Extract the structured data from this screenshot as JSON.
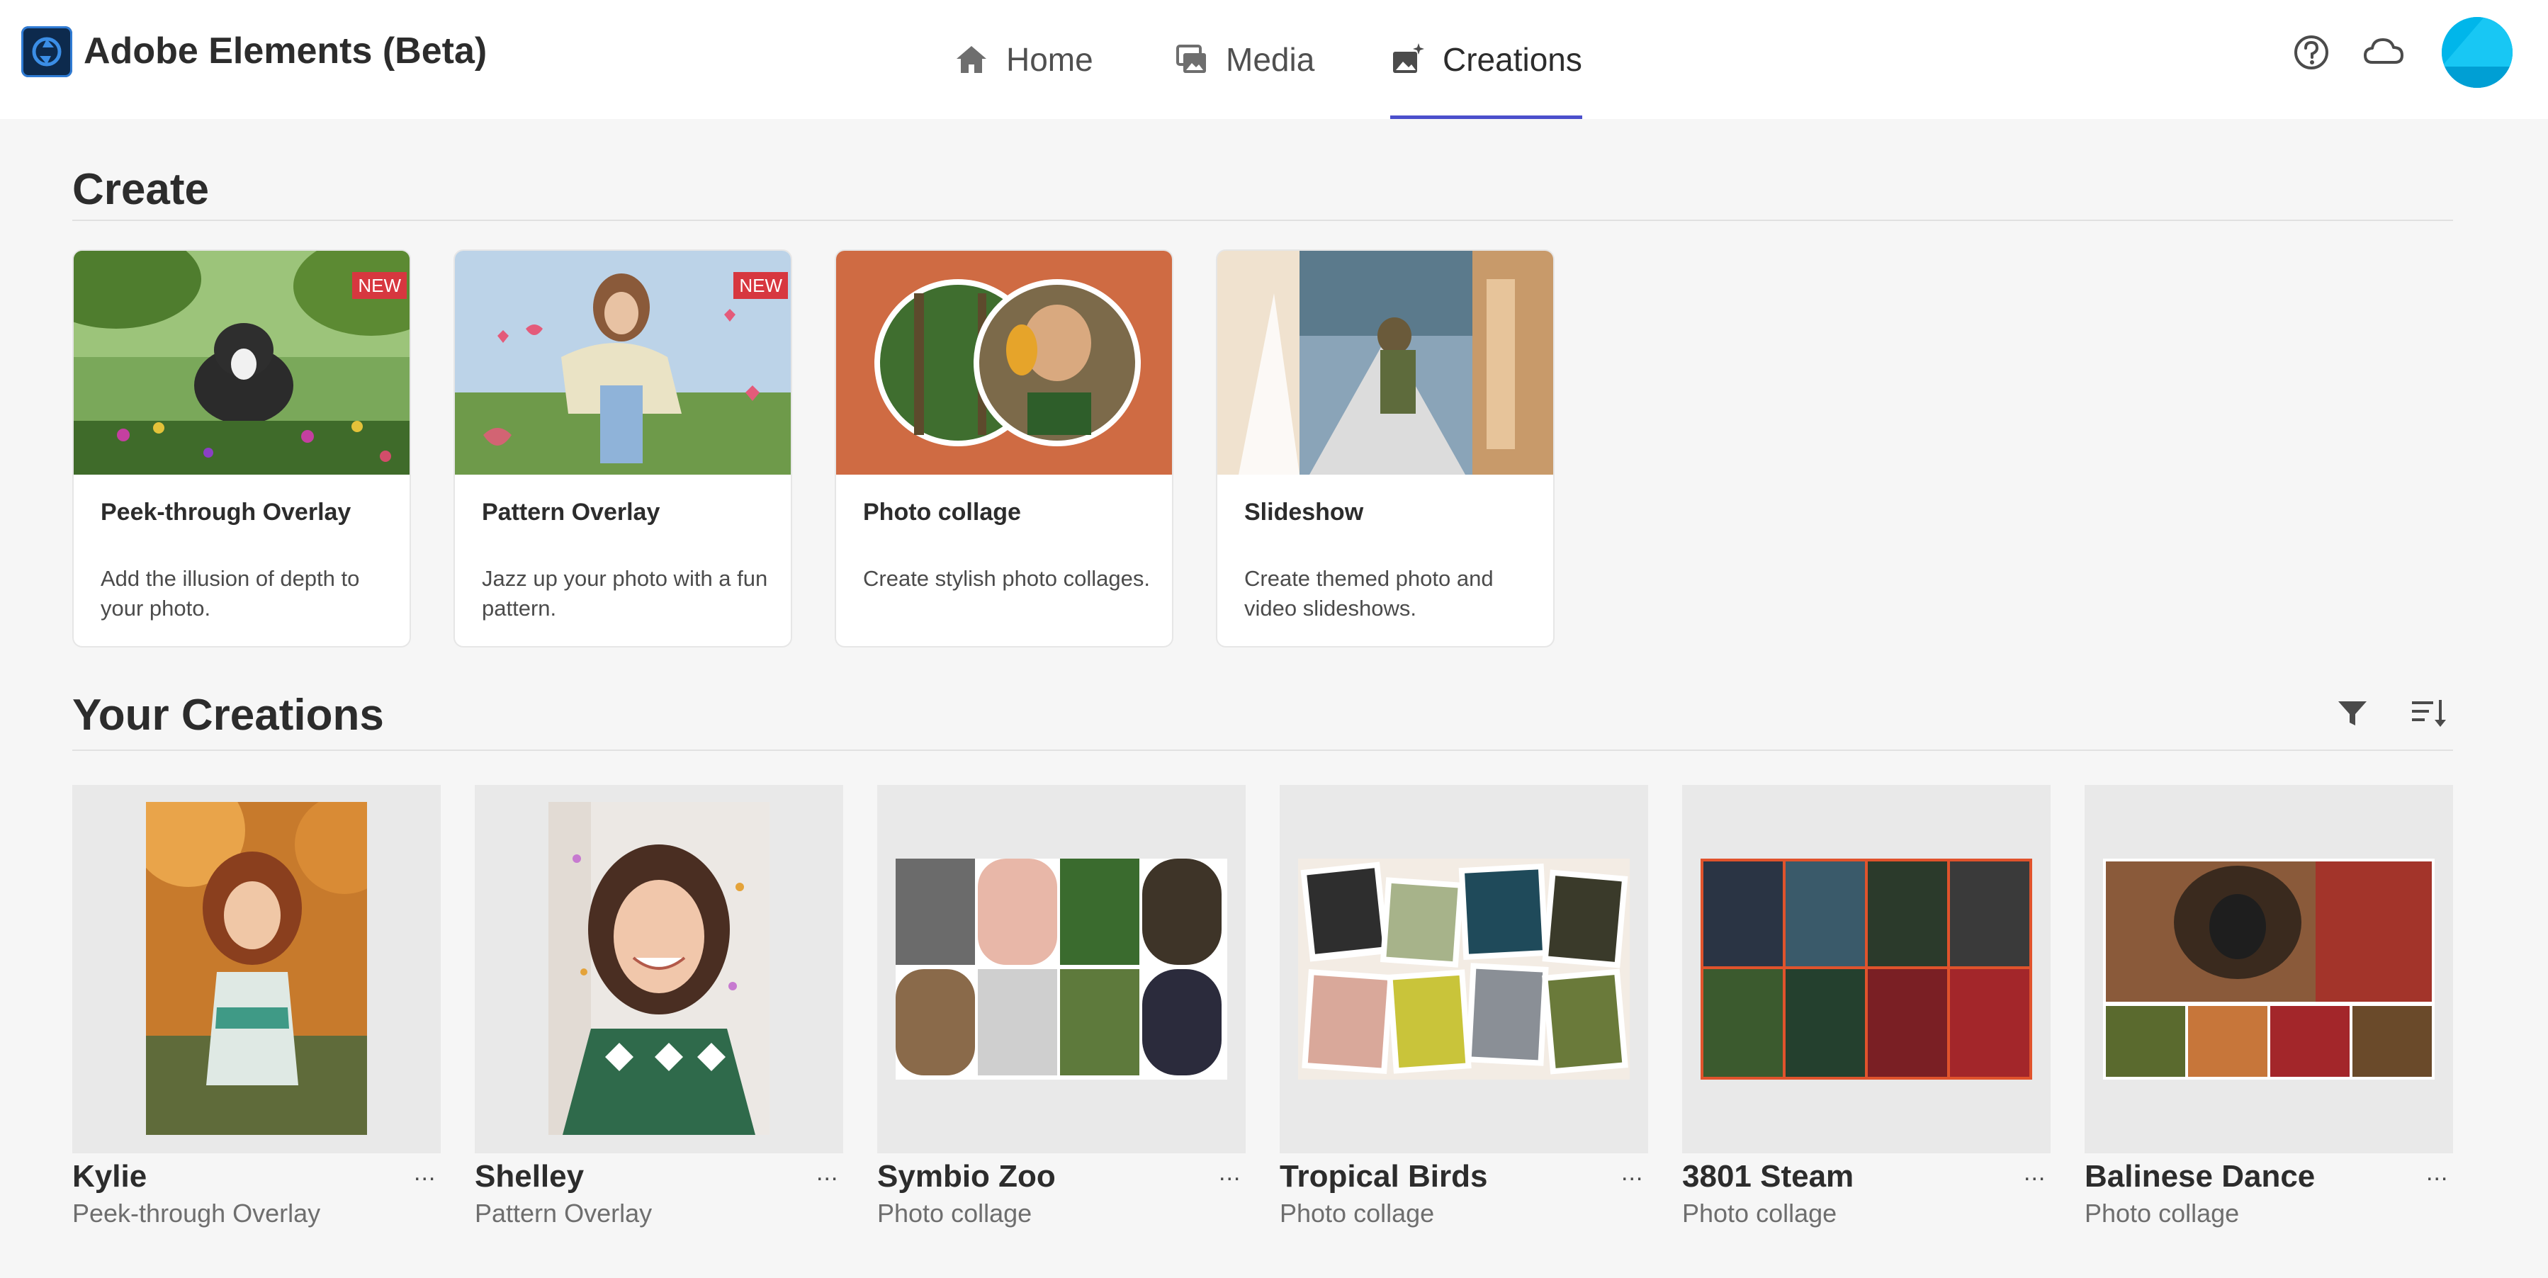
{
  "app": {
    "title": "Adobe Elements (Beta)"
  },
  "nav": {
    "tabs": [
      {
        "label": "Home",
        "icon": "home-icon",
        "active": false
      },
      {
        "label": "Media",
        "icon": "media-icon",
        "active": false
      },
      {
        "label": "Creations",
        "icon": "creations-icon",
        "active": true
      }
    ]
  },
  "header_icons": [
    "help-icon",
    "cloud-icon",
    "avatar"
  ],
  "create": {
    "title": "Create",
    "cards": [
      {
        "title": "Peek-through Overlay",
        "description": "Add the illusion of depth to your photo.",
        "badge": "NEW"
      },
      {
        "title": "Pattern Overlay",
        "description": "Jazz up your photo with a fun pattern.",
        "badge": "NEW"
      },
      {
        "title": "Photo collage",
        "description": "Create stylish photo collages."
      },
      {
        "title": "Slideshow",
        "description": "Create themed photo and video slideshows."
      }
    ]
  },
  "creations": {
    "title": "Your Creations",
    "tools": [
      "filter-icon",
      "sort-icon"
    ],
    "items": [
      {
        "name": "Kylie",
        "type": "Peek-through Overlay",
        "more": "..."
      },
      {
        "name": "Shelley",
        "type": "Pattern Overlay",
        "more": "..."
      },
      {
        "name": "Symbio Zoo",
        "type": "Photo collage",
        "more": "..."
      },
      {
        "name": "Tropical Birds",
        "type": "Photo collage",
        "more": "..."
      },
      {
        "name": "3801 Steam",
        "type": "Photo collage",
        "more": "..."
      },
      {
        "name": "Balinese Dance",
        "type": "Photo collage",
        "more": "..."
      }
    ]
  },
  "colors": {
    "accent": "#4b4fcc",
    "badge": "#d7373f",
    "avatar": "#00b6ea",
    "background": "#f6f6f6"
  }
}
